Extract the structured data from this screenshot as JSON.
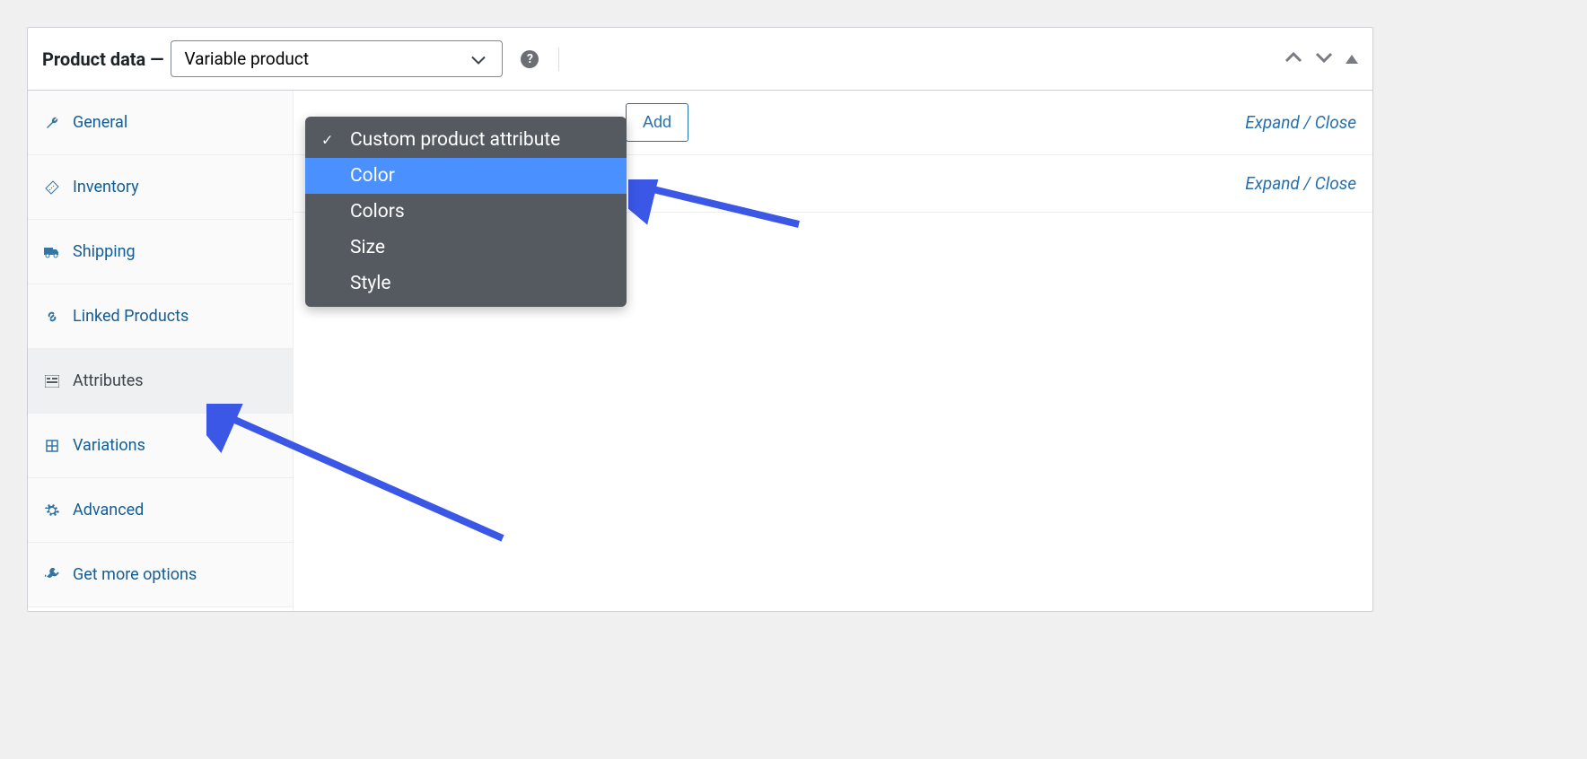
{
  "header": {
    "title": "Product data —",
    "product_type": "Variable product"
  },
  "tabs": [
    {
      "id": "general",
      "label": "General",
      "icon": "wrench"
    },
    {
      "id": "inventory",
      "label": "Inventory",
      "icon": "ruler"
    },
    {
      "id": "shipping",
      "label": "Shipping",
      "icon": "truck"
    },
    {
      "id": "linked",
      "label": "Linked Products",
      "icon": "link"
    },
    {
      "id": "attributes",
      "label": "Attributes",
      "icon": "list",
      "active": true
    },
    {
      "id": "variations",
      "label": "Variations",
      "icon": "grid"
    },
    {
      "id": "advanced",
      "label": "Advanced",
      "icon": "gear"
    },
    {
      "id": "get-more",
      "label": "Get more options",
      "icon": "plug"
    }
  ],
  "toolbar": {
    "add_label": "Add",
    "expand_close": "Expand / Close"
  },
  "dropdown": {
    "items": [
      {
        "label": "Custom product attribute",
        "checked": true
      },
      {
        "label": "Color",
        "highlighted": true
      },
      {
        "label": "Colors"
      },
      {
        "label": "Size"
      },
      {
        "label": "Style"
      }
    ]
  }
}
